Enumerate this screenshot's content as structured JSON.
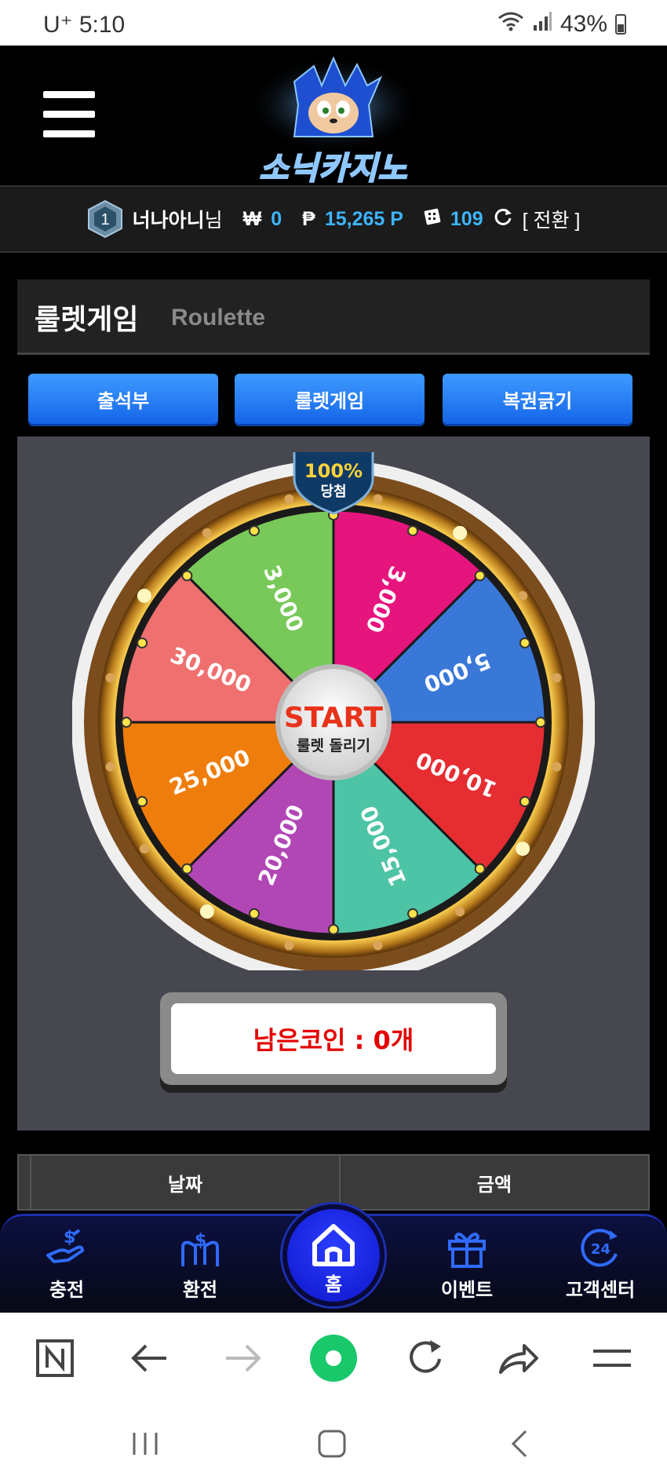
{
  "status_bar": {
    "carrier": "U⁺",
    "time": "5:10",
    "battery": "43%"
  },
  "header": {
    "logo_text": "소닉카지노"
  },
  "user": {
    "level": "1",
    "name": "너나아니",
    "suffix": "님",
    "won_symbol": "₩",
    "won": "0",
    "point_symbol": "₱",
    "points": "15,265 P",
    "tickets": "109",
    "switch_label": "[ 전환 ]"
  },
  "page_title": {
    "ko": "룰렛게임",
    "en": "Roulette"
  },
  "tabs": [
    {
      "label": "출석부"
    },
    {
      "label": "룰렛게임"
    },
    {
      "label": "복권긁기"
    }
  ],
  "wheel": {
    "badge_main": "100%",
    "badge_sub": "당첨",
    "start_label": "START",
    "start_sub": "룰렛 돌리기",
    "segments": [
      {
        "label": "3,000",
        "color": "#e6157e"
      },
      {
        "label": "5,000",
        "color": "#3a78d8"
      },
      {
        "label": "10,000",
        "color": "#e62d32"
      },
      {
        "label": "15,000",
        "color": "#4ec4a6"
      },
      {
        "label": "20,000",
        "color": "#b147b5"
      },
      {
        "label": "25,000",
        "color": "#ef7d0b"
      },
      {
        "label": "30,000",
        "color": "#f07070"
      },
      {
        "label": "3,000",
        "color": "#79c95a"
      }
    ]
  },
  "coins": {
    "text": "남은코인 : 0개"
  },
  "table": {
    "headers": [
      "날짜",
      "금액"
    ]
  },
  "bottom_nav": {
    "items": [
      {
        "label": "충전",
        "icon": "charge-icon"
      },
      {
        "label": "환전",
        "icon": "exchange-icon"
      },
      {
        "label": "홈",
        "icon": "home-icon"
      },
      {
        "label": "이벤트",
        "icon": "gift-icon"
      },
      {
        "label": "고객센터",
        "icon": "support-24-icon"
      }
    ]
  },
  "colors": {
    "accent_blue": "#1d6cf0",
    "point_blue": "#3db4ff",
    "coin_red": "#e40000"
  }
}
